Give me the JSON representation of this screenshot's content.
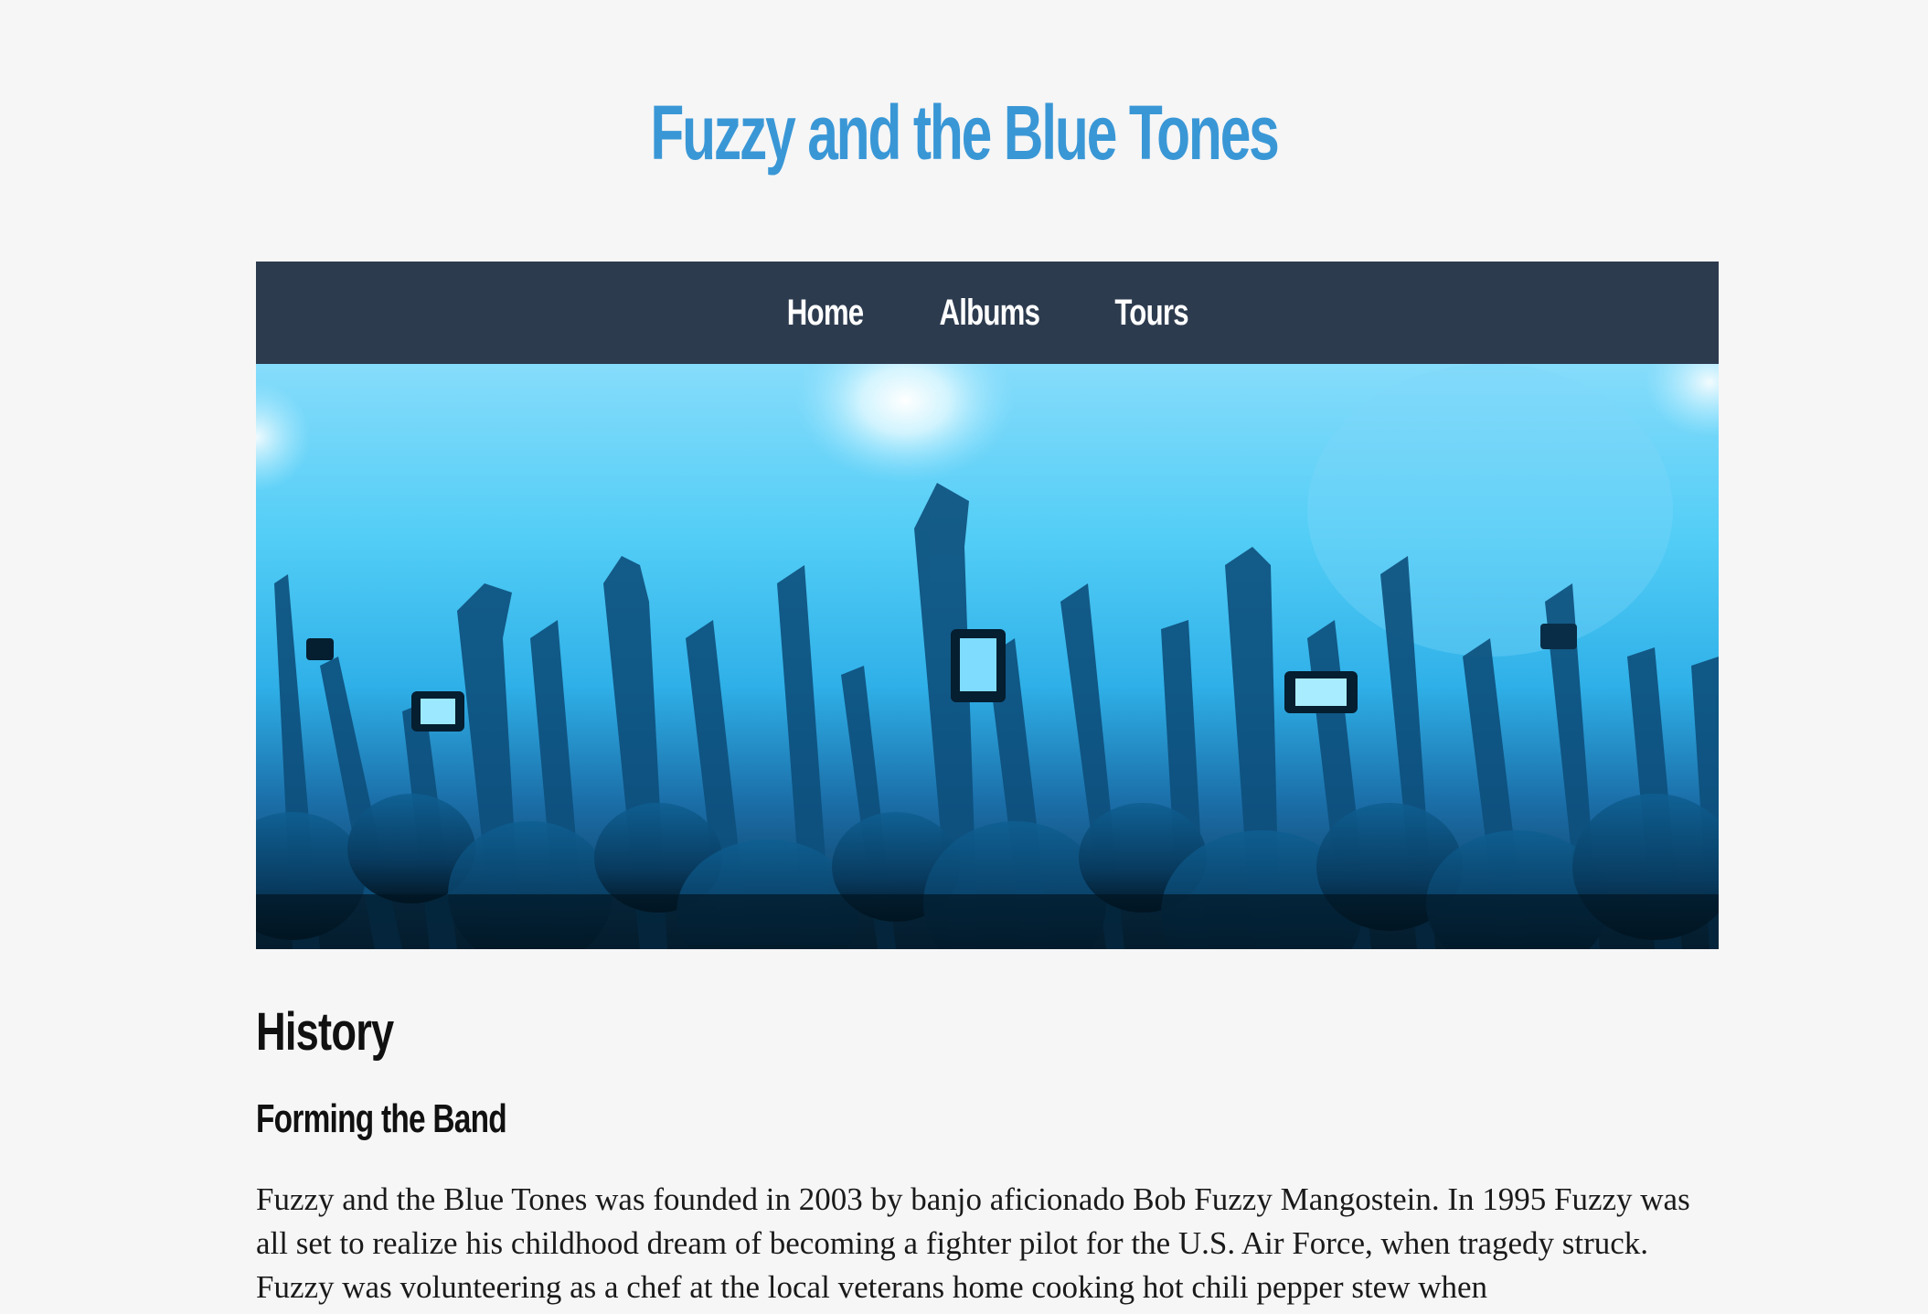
{
  "site": {
    "title": "Fuzzy and the Blue Tones"
  },
  "nav": {
    "items": [
      {
        "label": "Home"
      },
      {
        "label": "Albums"
      },
      {
        "label": "Tours"
      }
    ]
  },
  "hero": {
    "image_subject": "concert crowd with raised hands",
    "tint_color": "#3ec2f2"
  },
  "content": {
    "heading": "History",
    "subheading": "Forming the Band",
    "paragraph": "Fuzzy and the Blue Tones was founded in 2003 by banjo aficionado Bob Fuzzy Mangostein. In 1995 Fuzzy was all set to realize his childhood dream of becoming a fighter pilot for the U.S. Air Force, when tragedy struck. Fuzzy was volunteering as a chef at the local veterans home cooking hot chili pepper stew when"
  },
  "colors": {
    "title": "#3a97d6",
    "navbar": "#2d3b4f",
    "page_background": "#f6f6f6"
  }
}
